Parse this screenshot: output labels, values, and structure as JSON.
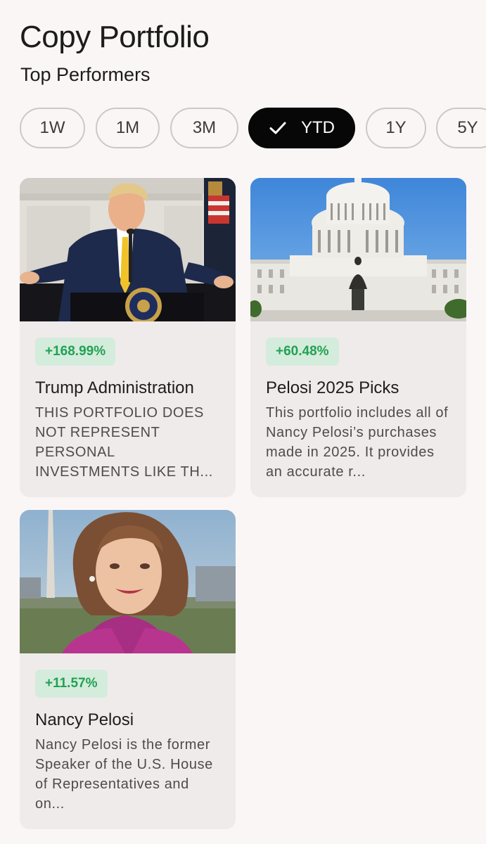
{
  "header": {
    "title": "Copy Portfolio",
    "subtitle": "Top Performers"
  },
  "filters": {
    "options": [
      "1W",
      "1M",
      "3M",
      "YTD",
      "1Y",
      "5Y"
    ],
    "selected": "YTD"
  },
  "colors": {
    "background": "#faf6f6",
    "card_background": "#efebeb",
    "chip_active": "#070707",
    "gain_text": "#22a154",
    "gain_background": "#d4ecdc"
  },
  "portfolios": [
    {
      "name": "Trump Administration",
      "gain": "+168.99%",
      "description": "THIS PORTFOLIO DOES NOT REPRESENT PERSONAL INVESTMENTS LIKE TH...",
      "image": "man-at-podium-photo"
    },
    {
      "name": "Pelosi 2025 Picks",
      "gain": "+60.48%",
      "description": "This portfolio includes all of Nancy Pelosi’s purchases made in 2025. It provides an accurate r...",
      "image": "capitol-building-photo"
    },
    {
      "name": "Nancy Pelosi",
      "gain": "+11.57%",
      "description": "Nancy Pelosi is the former Speaker of the U.S. House of Representatives and on...",
      "image": "woman-portrait-photo"
    }
  ]
}
